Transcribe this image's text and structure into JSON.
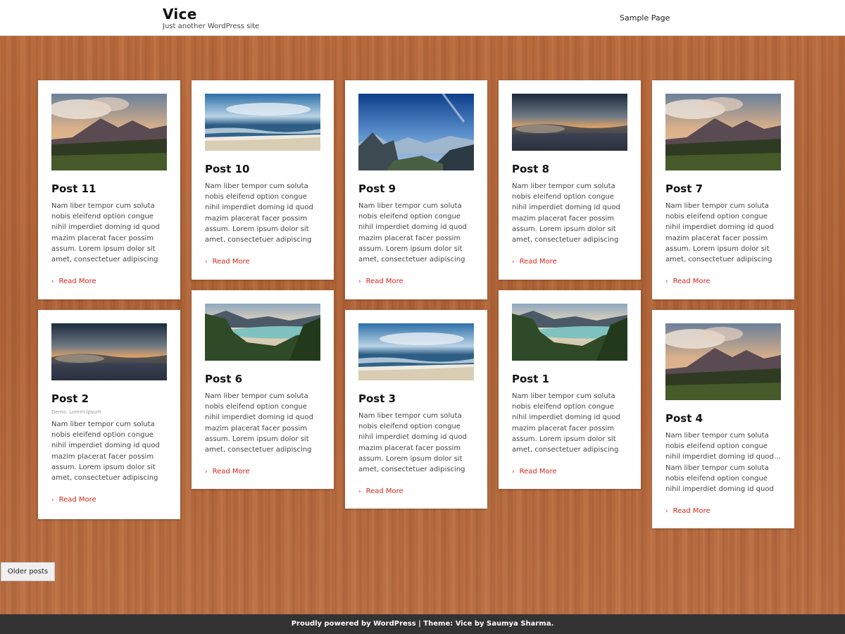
{
  "site": {
    "title": "Vice",
    "tagline": "Just another WordPress site",
    "nav": [
      {
        "label": "Sample Page"
      }
    ]
  },
  "read_more_label": "Read More",
  "read_more_color": "#d0271d",
  "posts": [
    {
      "title": "Post 11",
      "image": "mountain-clouds-landscape",
      "excerpt": "Nam liber tempor cum soluta nobis eleifend option congue nihil imperdiet doming id quod mazim placerat facer possim assum. Lorem ipsum dolor sit amet, consectetuer adipiscing elit, sed diam nonummy",
      "meta": ""
    },
    {
      "title": "Post 10",
      "image": "ocean-beach-waves",
      "excerpt": "Nam liber tempor cum soluta nobis eleifend option congue nihil imperdiet doming id quod mazim placerat facer possim assum. Lorem ipsum dolor sit amet, consectetuer adipiscing elit, sed diam nonummy",
      "meta": ""
    },
    {
      "title": "Post 9",
      "image": "mountain-valley-blue-sky",
      "excerpt": "Nam liber tempor cum soluta nobis eleifend option congue nihil imperdiet doming id quod mazim placerat facer possim assum. Lorem ipsum dolor sit amet, consectetuer adipiscing elit, sed diam nonummy",
      "meta": ""
    },
    {
      "title": "Post 8",
      "image": "sunset-horizon-sea",
      "excerpt": "Nam liber tempor cum soluta nobis eleifend option congue nihil imperdiet doming id quod mazim placerat facer possim assum. Lorem ipsum dolor sit amet, consectetuer adipiscing elit, sed diam nonummy",
      "meta": ""
    },
    {
      "title": "Post 7",
      "image": "mountain-clouds-landscape",
      "excerpt": "Nam liber tempor cum soluta nobis eleifend option congue nihil imperdiet doming id quod mazim placerat facer possim assum. Lorem ipsum dolor sit amet, consectetuer adipiscing elit, sed diam nonummy",
      "meta": ""
    },
    {
      "title": "Post 2",
      "image": "sunset-horizon-sea",
      "excerpt": "Nam liber tempor cum soluta nobis eleifend option congue nihil imperdiet doming id quod mazim placerat facer possim assum. Lorem ipsum dolor sit amet, consectetuer adipiscing elit, sed diam nonummy",
      "meta": "Demo, Lorem Ipsum"
    },
    {
      "title": "Post 6",
      "image": "lake-forest-mountains",
      "excerpt": "Nam liber tempor cum soluta nobis eleifend option congue nihil imperdiet doming id quod mazim placerat facer possim assum. Lorem ipsum dolor sit amet, consectetuer adipiscing elit, sed diam nonummy",
      "meta": ""
    },
    {
      "title": "Post 3",
      "image": "ocean-beach-waves",
      "excerpt": "Nam liber tempor cum soluta nobis eleifend option congue nihil imperdiet doming id quod mazim placerat facer possim assum. Lorem ipsum dolor sit amet, consectetuer adipiscing elit, sed diam nonummy",
      "meta": ""
    },
    {
      "title": "Post 1",
      "image": "lake-forest-mountains",
      "excerpt": "Nam liber tempor cum soluta nobis eleifend option congue nihil imperdiet doming id quod mazim placerat facer possim assum. Lorem ipsum dolor sit amet, consectetuer adipiscing elit, sed diam nonummy",
      "meta": ""
    },
    {
      "title": "Post 4",
      "image": "mountain-clouds-landscape",
      "excerpt": "Nam liber tempor cum soluta nobis eleifend option congue nihil imperdiet doming id quod… Nam liber tempor cum soluta nobis eleifend option congue nihil imperdiet doming id quod mazim p",
      "meta": ""
    }
  ],
  "pagination": {
    "older_label": "Older posts"
  },
  "footer": {
    "text": "Proudly powered by WordPress | Theme: Vice by Saumya Sharma."
  }
}
